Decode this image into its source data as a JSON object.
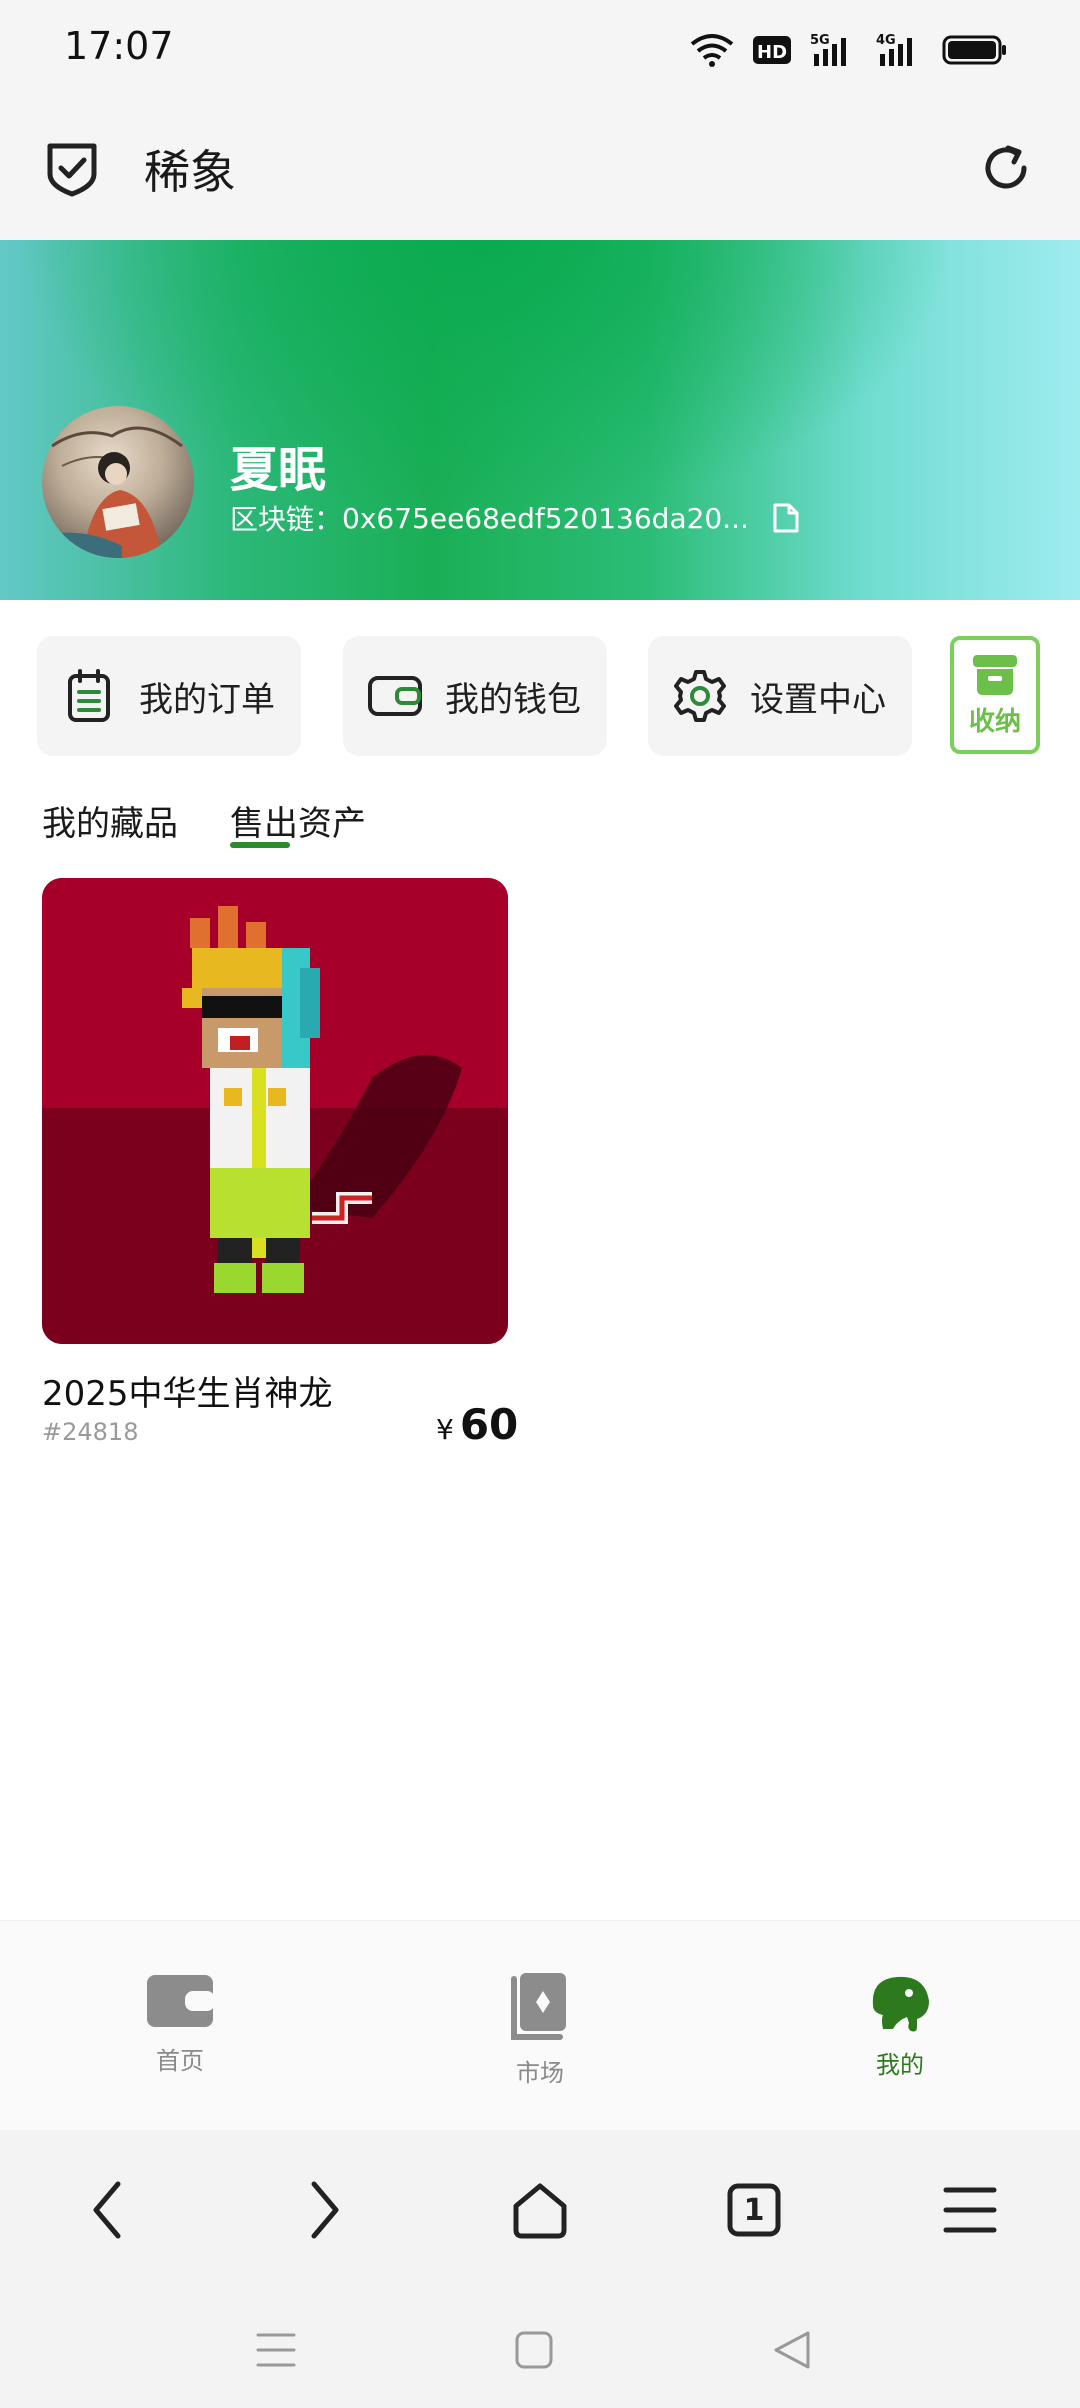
{
  "status_bar": {
    "time": "17:07"
  },
  "header": {
    "title": "稀象"
  },
  "profile": {
    "name": "夏眠",
    "chain_label": "区块链：",
    "chain_address": "0x675ee68edf520136da20..."
  },
  "actions": [
    {
      "label": "我的订单",
      "icon": "clipboard-icon"
    },
    {
      "label": "我的钱包",
      "icon": "wallet-icon"
    },
    {
      "label": "设置中心",
      "icon": "gear-icon"
    }
  ],
  "storage": {
    "label": "收纳",
    "icon": "archive-box-icon"
  },
  "tabs": [
    {
      "label": "我的藏品",
      "active": false
    },
    {
      "label": "售出资产",
      "active": true
    }
  ],
  "items": [
    {
      "title": "2025中华生肖神龙",
      "id": "#24818",
      "currency": "¥",
      "price": "60"
    }
  ],
  "bottom_nav": [
    {
      "label": "首页",
      "icon": "wallet-icon",
      "active": false
    },
    {
      "label": "市场",
      "icon": "book-icon",
      "active": false
    },
    {
      "label": "我的",
      "icon": "elephant-icon",
      "active": true
    }
  ],
  "browser": {
    "tab_count": "1"
  },
  "colors": {
    "accent": "#2d7a1e",
    "storage_border": "#7ad05a",
    "item_bg": "#9a0020"
  }
}
